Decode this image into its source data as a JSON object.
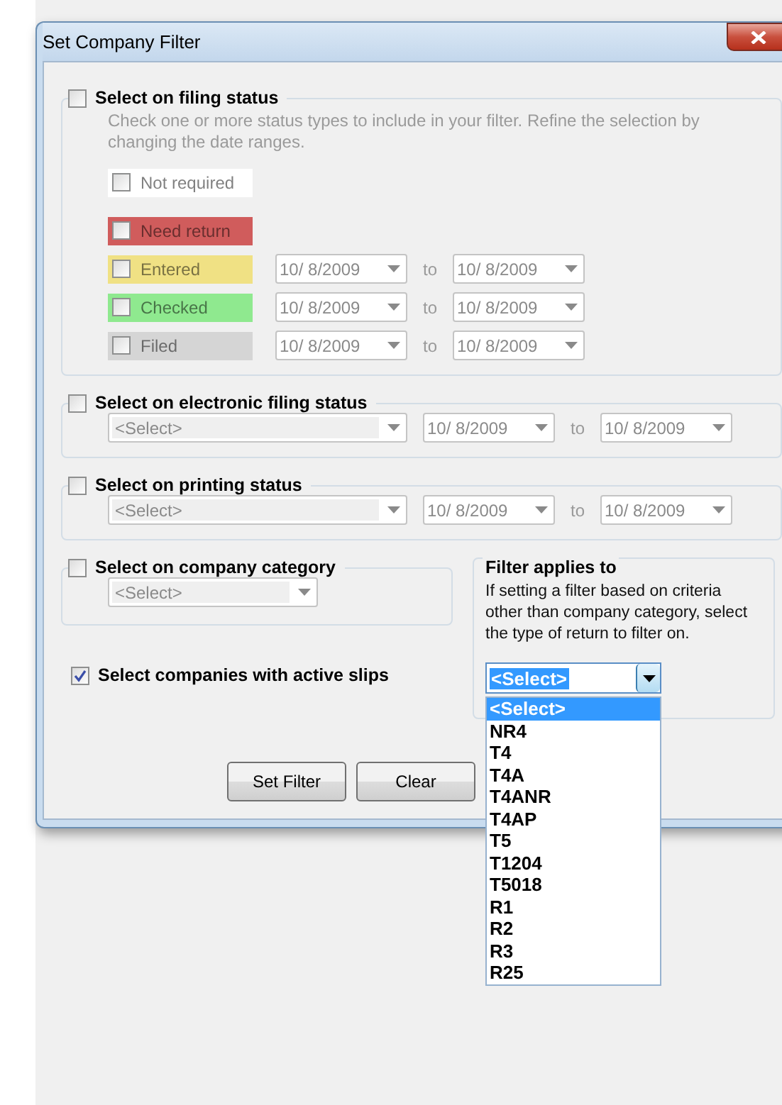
{
  "window": {
    "title": "Set Company Filter"
  },
  "filing_status": {
    "label": "Select on filing status",
    "checked": false,
    "hint": "Check one or more status types to include in your filter. Refine the selection by changing the date ranges.",
    "statuses": [
      {
        "label": "Not required",
        "checked": false,
        "color": "#ffffff"
      },
      {
        "label": "Need return",
        "checked": false,
        "color": "#d05c5c"
      },
      {
        "label": "Entered",
        "checked": false,
        "color": "#f0e184",
        "from": "10/ 8/2009",
        "to_label": "to",
        "to": "10/ 8/2009"
      },
      {
        "label": "Checked",
        "checked": false,
        "color": "#8fe98f",
        "from": "10/ 8/2009",
        "to_label": "to",
        "to": "10/ 8/2009"
      },
      {
        "label": "Filed",
        "checked": false,
        "color": "#d5d5d5",
        "from": "10/ 8/2009",
        "to_label": "to",
        "to": "10/ 8/2009"
      }
    ]
  },
  "electronic_filing": {
    "label": "Select on electronic filing status",
    "checked": false,
    "select": "<Select>",
    "from": "10/ 8/2009",
    "to_label": "to",
    "to": "10/ 8/2009"
  },
  "printing": {
    "label": "Select on printing status",
    "checked": false,
    "select": "<Select>",
    "from": "10/ 8/2009",
    "to_label": "to",
    "to": "10/ 8/2009"
  },
  "company_category": {
    "label": "Select on company category",
    "checked": false,
    "select": "<Select>"
  },
  "active_slips": {
    "label": "Select companies with active slips",
    "checked": true
  },
  "filter_applies_to": {
    "title": "Filter applies to",
    "description": "If setting a filter based on criteria other than company category, select the type of return to filter on.",
    "select": "<Select>",
    "options": [
      {
        "label": "<Select>",
        "selected": true
      },
      {
        "label": "NR4",
        "selected": false
      },
      {
        "label": "T4",
        "selected": false
      },
      {
        "label": "T4A",
        "selected": false
      },
      {
        "label": "T4ANR",
        "selected": false
      },
      {
        "label": "T4AP",
        "selected": false
      },
      {
        "label": "T5",
        "selected": false
      },
      {
        "label": "T1204",
        "selected": false
      },
      {
        "label": "T5018",
        "selected": false
      },
      {
        "label": "R1",
        "selected": false
      },
      {
        "label": "R2",
        "selected": false
      },
      {
        "label": "R3",
        "selected": false
      },
      {
        "label": "R25",
        "selected": false
      }
    ]
  },
  "buttons": [
    "Set Filter",
    "Clear"
  ]
}
